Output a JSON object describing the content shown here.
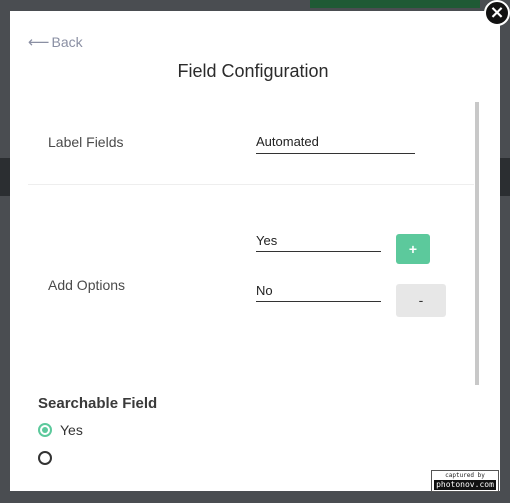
{
  "nav": {
    "back_label": "Back"
  },
  "modal": {
    "title": "Field Configuration",
    "close_glyph": "×"
  },
  "label_fields": {
    "label": "Label Fields",
    "value": "Automated"
  },
  "add_options": {
    "label": "Add Options",
    "options": [
      {
        "value": "Yes"
      },
      {
        "value": "No"
      }
    ],
    "add_button": "+",
    "remove_button": "-"
  },
  "searchable": {
    "label": "Searchable Field",
    "options": [
      {
        "label": "Yes",
        "checked": true
      },
      {
        "label": "",
        "checked": false
      }
    ]
  },
  "watermark": {
    "line1": "captured by",
    "line2": "photonov.com"
  },
  "colors": {
    "accent": "#5cc99c",
    "overlay": "#4a4d51",
    "brand_strip": "#1f5a35"
  },
  "icons": {
    "back": "arrow-left-icon",
    "close": "close-icon"
  }
}
